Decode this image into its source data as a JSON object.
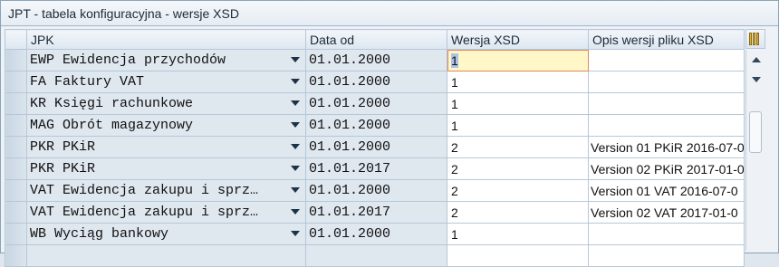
{
  "window": {
    "title": "JPT - tabela konfiguracyjna - wersje XSD"
  },
  "table": {
    "headers": {
      "jpk": "JPK",
      "date": "Data od",
      "version": "Wersja XSD",
      "description": "Opis wersji pliku XSD"
    },
    "rows": [
      {
        "jpk": "EWP Ewidencja przychodów",
        "date": "01.01.2000",
        "version": "1",
        "description": ""
      },
      {
        "jpk": "FA Faktury VAT",
        "date": "01.01.2000",
        "version": "1",
        "description": ""
      },
      {
        "jpk": "KR Księgi rachunkowe",
        "date": "01.01.2000",
        "version": "1",
        "description": ""
      },
      {
        "jpk": "MAG Obrót magazynowy",
        "date": "01.01.2000",
        "version": "1",
        "description": ""
      },
      {
        "jpk": "PKR PKiR",
        "date": "01.01.2000",
        "version": "2",
        "description": "Version 01 PKiR 2016-07-0"
      },
      {
        "jpk": "PKR PKiR",
        "date": "01.01.2017",
        "version": "2",
        "description": "Version 02 PKiR 2017-01-0"
      },
      {
        "jpk": "VAT Ewidencja zakupu i sprz…",
        "date": "01.01.2000",
        "version": "2",
        "description": "Version 01 VAT 2016-07-0"
      },
      {
        "jpk": "VAT Ewidencja zakupu i sprz…",
        "date": "01.01.2017",
        "version": "2",
        "description": "Version 02 VAT 2017-01-0"
      },
      {
        "jpk": "WB Wyciąg bankowy",
        "date": "01.01.2000",
        "version": "1",
        "description": ""
      }
    ]
  },
  "icons": {
    "settings": "column-settings-icon",
    "scroll_up": "scroll-up-icon",
    "scroll_down": "scroll-down-icon"
  },
  "colors": {
    "active_cell": "#fff7c8",
    "active_border": "#e08a5e",
    "selection": "#aac4e6"
  }
}
